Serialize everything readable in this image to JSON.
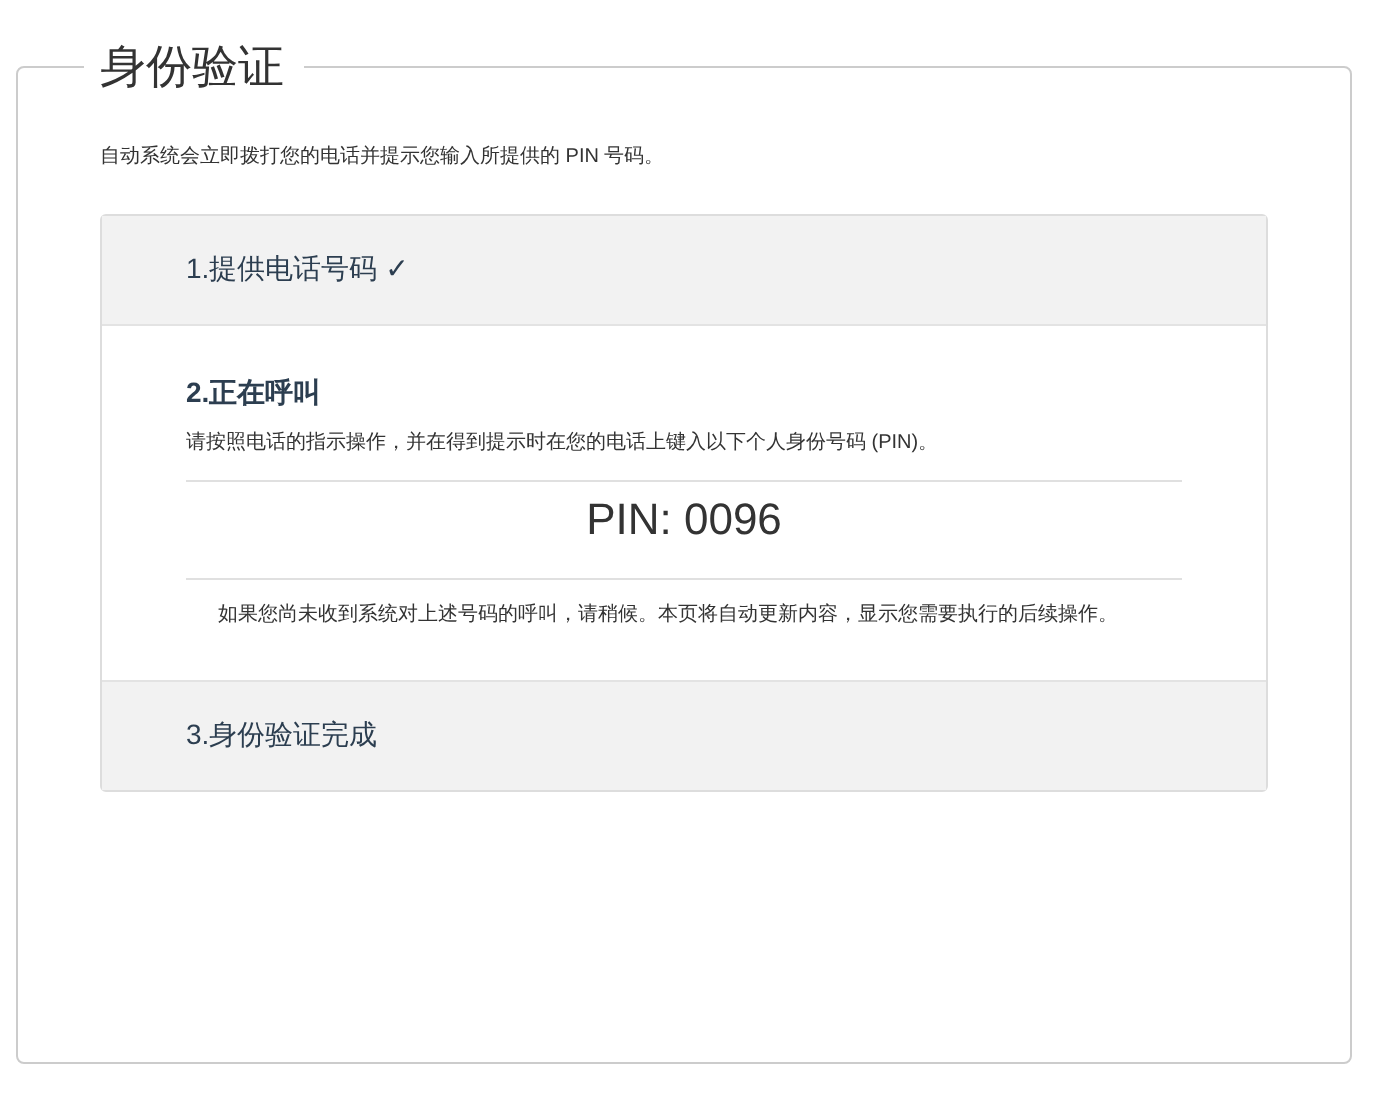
{
  "title": "身份验证",
  "intro": "自动系统会立即拨打您的电话并提示您输入所提供的 PIN 号码。",
  "steps": [
    {
      "title": "1.提供电话号码 ✓",
      "expanded": false
    },
    {
      "title": "2.正在呼叫",
      "expanded": true,
      "instruction": "请按照电话的指示操作，并在得到提示时在您的电话上键入以下个人身份号码 (PIN)。",
      "pin": "PIN: 0096",
      "note": "如果您尚未收到系统对上述号码的呼叫，请稍候。本页将自动更新内容，显示您需要执行的后续操作。"
    },
    {
      "title": "3.身份验证完成",
      "expanded": false
    }
  ]
}
